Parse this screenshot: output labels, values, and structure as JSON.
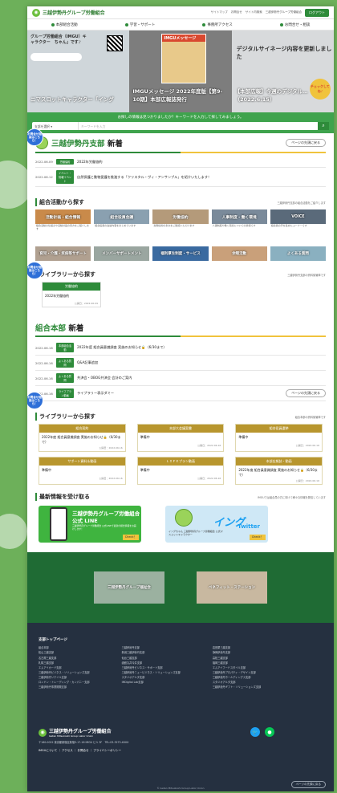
{
  "header": {
    "org_name": "三越伊勢丹グループ労働組合",
    "top_links": [
      "サイトマップ",
      "お問合せ",
      "サイト内検索",
      "三越伊勢丹グループ労働組合"
    ],
    "logout": "ログアウト"
  },
  "gnav": [
    "本部組合活動",
    "学習・サポート",
    "事務所アクセス",
    "お問合せ・相談"
  ],
  "hero": {
    "slide1_text": "グループ労働組合（IMGU）キャラクター　ちゃん」です♪",
    "slide1_caption": "ニマスコットキャラクター「イング",
    "slide2_caption": "IMGUメッセージ 2022年度版【第9-10期】本部広報誌発行",
    "slide2_mag": "IMGUメッセージ",
    "slide3_text": "デジタルサイネージ内容を更新しました",
    "slide3_caption": "【本部広報】今週のデジタル…（2022.6.15）",
    "bubble": "チェックしてね♪"
  },
  "search": {
    "prompt": "お探しの情報は見つかりましたか？キーワードを入力して探してみましょう。",
    "select_label": "支部を選択",
    "keyword_placeholder": "キーワードを入力"
  },
  "branch": {
    "title_accent": "三越伊勢丹支部",
    "title_rest": " 新着",
    "pagetop": "ページの先頭に戻る",
    "news": [
      {
        "date": "2022.06.09",
        "tag": "労働協約",
        "title": "2022年労働協約"
      },
      {
        "date": "2022.06.12",
        "tag": "イベント・情報イベント",
        "title": "自然保護と動物愛護を推進する「クリスタル・ヴィ・アンサンブル」を紹介いたします！"
      }
    ]
  },
  "activities": {
    "title": "組合活動から探す",
    "note": "三越伊勢丹支部の組合活動をご紹介します",
    "tiles": [
      {
        "label": "活動計画・組合情報",
        "desc": "組合活動の仕組みや活動計画の見方をご紹介します"
      },
      {
        "label": "組合役員会議",
        "desc": "組合役員の会議内容をまとめています"
      },
      {
        "label": "労働協約",
        "desc": "労働協約の条文をご確認いただけます"
      },
      {
        "label": "人事制度・働く環境",
        "desc": "人事制度や働く環境についての情報です"
      },
      {
        "label": "VOICE",
        "desc": "組合員の声を集めたコーナーです"
      }
    ],
    "tiles2": [
      "育児・介護・疾病等サポート",
      "メンバーサポートメント",
      "福利厚生制度・サービス",
      "余暇活動",
      "よくある質問"
    ]
  },
  "library1": {
    "title": "ライブラリーから探す",
    "note": "三越伊勢丹支部の資料保管庫です",
    "card": {
      "head": "労働協約",
      "body": "2022年労働協約",
      "date": "公開日：2022.06.09"
    }
  },
  "hq": {
    "title_accent": "組合本部",
    "title_rest": " 新着",
    "pagetop": "ページの先頭に戻る",
    "news": [
      {
        "date": "2022.06.16",
        "tag": "本部組合活動",
        "title": "2022年度 組合員意識調査 実施のお知らせ🔒（6/30まで）"
      },
      {
        "date": "2022.06.16",
        "tag": "よくある質問",
        "title": "Q&A記事追加"
      },
      {
        "date": "2022.06.16",
        "tag": "よくある質問",
        "title": "共済会・OBOG共済会 会計のご案内"
      },
      {
        "date": "2022.06.16",
        "tag": "ライフプラン動画",
        "title": "ライブラリー表示ダミー"
      }
    ]
  },
  "library2": {
    "title": "ライブラリーから探す",
    "note": "組合本部の資料保管庫です",
    "cards": [
      {
        "head": "組合契約",
        "body": "2022年度 組合員意識調査 実施のお知らせ🔒（6/30まで）",
        "date": "公開日：2022.06.16"
      },
      {
        "head": "本部大会議案書",
        "body": "準備中",
        "date": "公開日：2022.06.16"
      },
      {
        "head": "組合役員選挙",
        "body": "準備中",
        "date": "公開日：2022.06.16"
      },
      {
        "head": "サポート資料＆動画",
        "body": "準備中",
        "date": "公開日：2022.06.16"
      },
      {
        "head": "ＬＩＦＥプラン動画",
        "body": "準備中",
        "date": "公開日：2022.06.16"
      },
      {
        "head": "本部広報誌・動画",
        "body": "2022年度 組合員意識調査 実施のお知らせ🔒（6/30まで）",
        "date": "公開日：2022.06.16"
      }
    ]
  },
  "latest": {
    "title": "最新情報を受け取る",
    "note": "IMGUでは組合員の方に向けて様々な情報を発信しています",
    "line_main": "三越伊勢丹グループ労働組合公式 LINE",
    "line_sub": "三越伊勢丹グループ労働組合 公式LINEで最新の組合情報をお届けします！",
    "twitter_main": "イング",
    "twitter_sub": "イングちゃん 三越伊勢丹グループ労働組合 公式マスコットキャラクター",
    "twitter_word": "Twitter",
    "check": "Check！"
  },
  "greenband": [
    "三越伊勢丹グループ福祉会",
    "ベネフィット・ステーション"
  ],
  "side_buttons": "お問合せ相談はこちら！",
  "footer": {
    "heading": "支部トップページ",
    "col1": [
      "組合本部",
      "松山三越支部",
      "名古屋三越支部",
      "札幌三越支部",
      "エムアイカード支部",
      "三越伊勢丹ビジネス・ソリューションズ支部",
      "三越伊勢丹リテイル支部",
      "ロンドン・トレーディング・カンパニー支部",
      "三越伊勢丹事業開発支部"
    ],
    "col2": [
      "三越伊勢丹支部",
      "新潟三越伊勢丹支部",
      "仙台三越支部",
      "函館丸井今井支部",
      "三越伊勢丹ビジネス・サポート支部",
      "三越伊勢丹ニュービジネス・ソリューションズ支部",
      "スタジオアルタ支部",
      "IMDigital Lab支部"
    ],
    "col3": [
      "岩田屋三越支部",
      "静岡伊勢丹支部",
      "高松三越支部",
      "福岡三越支部",
      "エムアイフードスタイル支部",
      "三越伊勢丹プロパティ・デザイン支部",
      "三越伊勢丹ホールディングス支部",
      "スタジオアルタ支部",
      "三越伊勢丹ギフト・ソリューションズ支部"
    ],
    "org_name": "三越伊勢丹グループ労働組合",
    "org_en": "Isetan Mitsukoshi Group Labor Union",
    "address": "〒160-0022 東京都新宿区新宿3-17-16 IMGU ビル 3F　TEL:03-3273-XXXX",
    "links": "IMGUについて ｜ アクセス ｜ お問合せ ｜ プライバシーポリシー",
    "copyright": "© Isetan Mitsukoshi Group Labor Union",
    "pagetop": "ページの先頭に戻る"
  }
}
